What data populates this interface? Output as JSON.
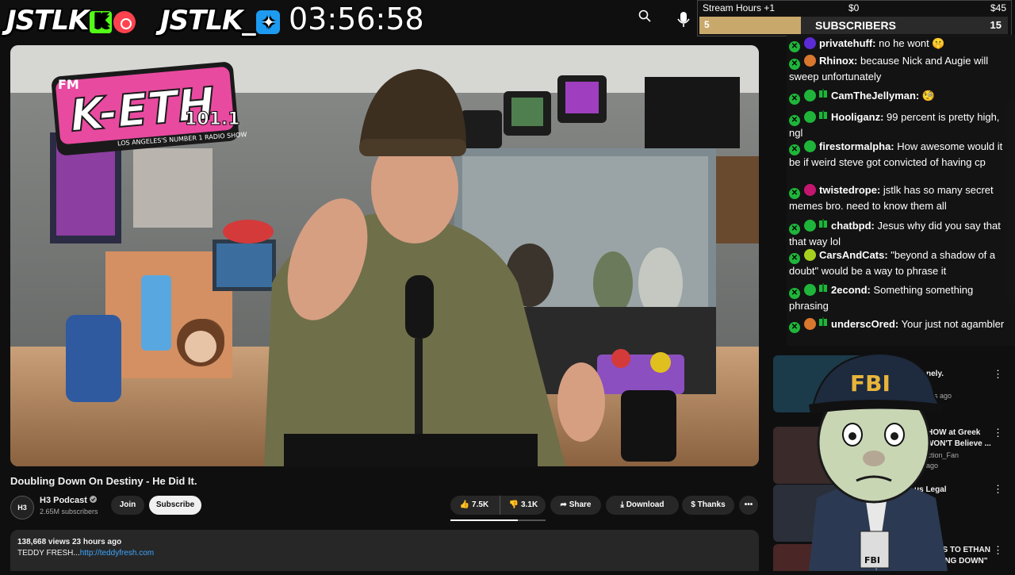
{
  "overlay": {
    "logo1": "JSTLK",
    "logo2": "JSTLK_",
    "clock": "03:56:58"
  },
  "stream_hours": {
    "title": "Stream Hours +1",
    "min_label": "$0",
    "max_label": "$45",
    "progress_fraction": 0.33,
    "count": "5",
    "subscribers_label": "SUBSCRIBERS",
    "subscribers_count": "15"
  },
  "video": {
    "title": "Doubling Down On Destiny - He Did It.",
    "station_letters": "K-ETH",
    "station_fm": "FM",
    "station_freq": "101.1",
    "station_tag": "LOS ANGELES'S NUMBER 1 RADIO SHOW"
  },
  "channel": {
    "avatar_text": "H3",
    "name": "H3 Podcast",
    "verified_icon": "check-circle-icon",
    "subscribers": "2.65M subscribers",
    "join_label": "Join",
    "subscribe_label": "Subscribe"
  },
  "actions": {
    "likes": "7.5K",
    "dislikes": "3.1K",
    "share": "Share",
    "download": "Download",
    "thanks": "Thanks",
    "like_ratio": 0.71
  },
  "description": {
    "stats": "138,668 views  23 hours ago",
    "text_prefix": "TEDDY FRESH...",
    "link": "http://teddyfresh.com"
  },
  "chat": {
    "messages": [
      {
        "user": "privatehuff:",
        "text": " no he wont 🤫",
        "avatar_color": "#5b2bd6",
        "gift": false
      },
      {
        "user": "Rhinox:",
        "text": " because Nick and Augie will sweep unfortunately",
        "avatar_color": "#d9772e",
        "gift": false
      },
      {
        "user": "CamTheJellyman:",
        "text": " 🧐",
        "avatar_color": "#1fb53a",
        "gift": true
      },
      {
        "user": "Hooliganz:",
        "text": " 99 percent is pretty high, ngl",
        "avatar_color": "#1fb53a",
        "gift": true
      },
      {
        "user": "firestormalpha:",
        "text": " How awesome would it be if weird steve got convicted of having cp",
        "avatar_color": "#1fb53a",
        "gift": false
      },
      {
        "user": "twistedrope:",
        "text": " jstlk has so many secret memes bro. need to know them all",
        "avatar_color": "#c4166f",
        "gift": false
      },
      {
        "user": "chatbpd:",
        "text": " Jesus why did you say that that way lol",
        "avatar_color": "#1fb53a",
        "gift": true
      },
      {
        "user": "CarsAndCats:",
        "text": " \"beyond a shadow of a doubt\" would be a way to phrase it",
        "avatar_color": "#a7d11f",
        "gift": false
      },
      {
        "user": "2econd:",
        "text": " Something something phrasing",
        "avatar_color": "#1fb53a",
        "gift": true
      },
      {
        "user": "underscOred:",
        "text": " Your just not agambler",
        "avatar_color": "#d9772e",
        "gift": true
      }
    ]
  },
  "recommendations": [
    {
      "title": "t lonely.",
      "meta": "months ago"
    },
    {
      "title": "E SHOW at Greek",
      "title2": "ou WON'T Believe ...",
      "meta": "Reaction_Fan",
      "meta2": "nth ago"
    },
    {
      "title": "us Legal",
      "meta": ""
    },
    {
      "title": "SPONDS TO ETHAN",
      "title2": "DOUBLING DOWN\"",
      "meta": ""
    }
  ],
  "fbi_overlay": {
    "cap_text": "FBI",
    "badge_text": "FBI"
  }
}
